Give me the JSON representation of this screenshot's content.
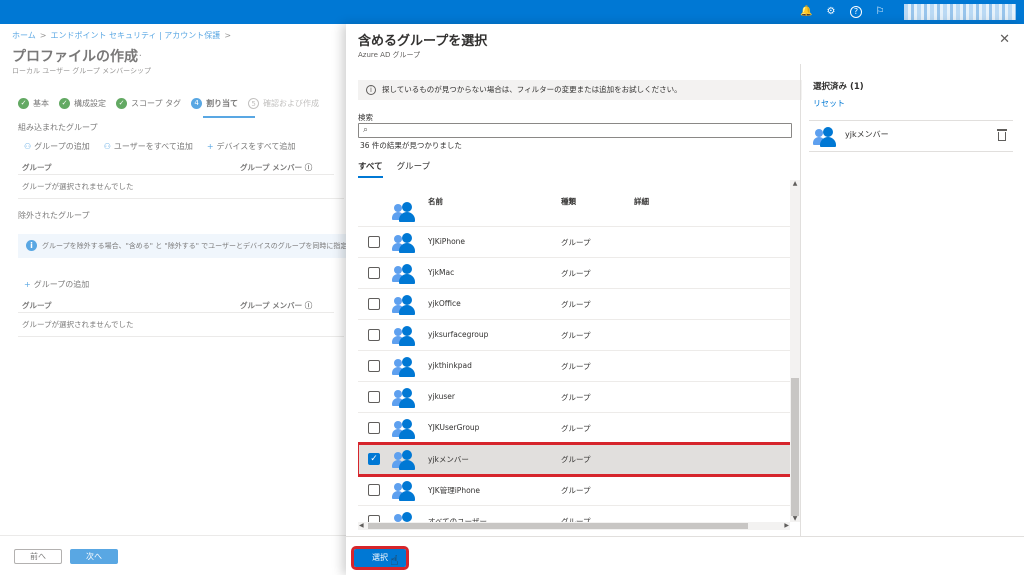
{
  "colors": {
    "accent": "#0078d4",
    "success": "#107c10",
    "highlight": "#d6252c"
  },
  "topbar": {
    "icons": [
      "bell-icon",
      "gear-icon",
      "help-icon",
      "feedback-icon"
    ],
    "glyphs": {
      "bell": "🔔",
      "gear": "⚙",
      "help": "?",
      "feedback": "⚐"
    }
  },
  "breadcrumb": {
    "items": [
      "ホーム",
      "エンドポイント セキュリティ | アカウント保護"
    ],
    "sep": ">"
  },
  "page": {
    "title": "プロファイルの作成",
    "more": "…",
    "subtitle": "ローカル ユーザー グループ メンバーシップ"
  },
  "steps": [
    {
      "label": "基本",
      "mark": "✓"
    },
    {
      "label": "構成設定",
      "mark": "✓"
    },
    {
      "label": "スコープ タグ",
      "mark": "✓"
    },
    {
      "label": "割り当て",
      "mark": "4"
    },
    {
      "label": "確認および作成",
      "mark": "5"
    }
  ],
  "included": {
    "title": "組み込まれたグループ",
    "actions": [
      {
        "icon": "⚇",
        "label": "グループの追加"
      },
      {
        "icon": "⚇",
        "label": "ユーザーをすべて追加"
      },
      {
        "icon": "+",
        "label": "デバイスをすべて追加"
      }
    ],
    "col_group": "グループ",
    "col_members": "グループ メンバー ⓘ",
    "empty": "グループが選択されませんでした"
  },
  "excluded": {
    "title": "除外されたグループ",
    "info": "グループを除外する場合、\"含める\" と \"除外する\" でユーザーとデバイスのグループを同時に指定することはで",
    "info_icon": "i",
    "add_icon": "+",
    "add_label": "グループの追加",
    "col_group": "グループ",
    "col_members": "グループ メンバー ⓘ",
    "empty": "グループが選択されませんでした"
  },
  "footer_left": {
    "prev": "前へ",
    "next": "次へ"
  },
  "blade": {
    "title": "含めるグループを選択",
    "subtitle": "Azure AD グループ",
    "close": "✕",
    "notice": "探しているものが見つからない場合は、フィルターの変更または追加をお試しください。",
    "notice_icon": "i",
    "search_label": "検索",
    "search_icon": "⌕",
    "search_value": "",
    "result_count": "36 件の結果が見つかりました",
    "tabs": [
      "すべて",
      "グループ"
    ],
    "columns": {
      "name": "名前",
      "type": "種類",
      "detail": "詳細"
    },
    "rows": [
      {
        "name": "YJKiPhone",
        "type": "グループ",
        "checked": false
      },
      {
        "name": "YjkMac",
        "type": "グループ",
        "checked": false
      },
      {
        "name": "yjkOffice",
        "type": "グループ",
        "checked": false
      },
      {
        "name": "yjksurfacegroup",
        "type": "グループ",
        "checked": false
      },
      {
        "name": "yjkthinkpad",
        "type": "グループ",
        "checked": false
      },
      {
        "name": "yjkuser",
        "type": "グループ",
        "checked": false
      },
      {
        "name": "YJKUserGroup",
        "type": "グループ",
        "checked": false
      },
      {
        "name": "yjkメンバー",
        "type": "グループ",
        "checked": true
      },
      {
        "name": "YJK管理iPhone",
        "type": "グループ",
        "checked": false
      },
      {
        "name": "すべてのユーザー",
        "type": "グループ",
        "checked": false
      }
    ],
    "checkmark": "✓",
    "selected_panel": {
      "title": "選択済み (1)",
      "reset": "リセット",
      "items": [
        {
          "name": "yjkメンバー"
        }
      ]
    },
    "select_button": "選択",
    "cursor": "☝",
    "scroll": {
      "up": "▲",
      "down": "▼",
      "left": "◀",
      "right": "▶"
    }
  }
}
